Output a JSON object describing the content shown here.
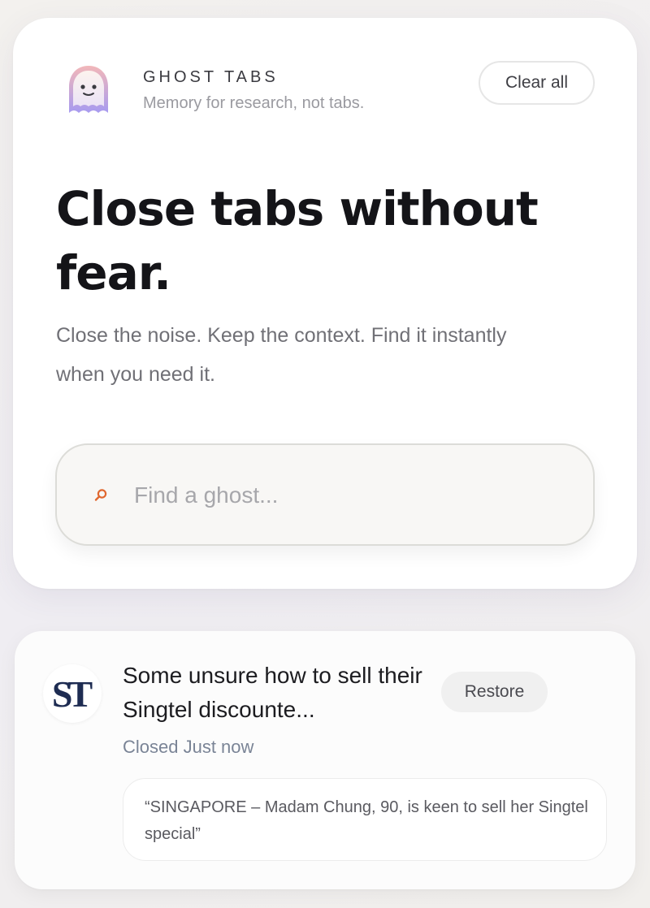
{
  "header": {
    "brand_name": "GHOST TABS",
    "tagline": "Memory for research, not tabs.",
    "clear_all_label": "Clear all"
  },
  "hero": {
    "heading": "Close tabs without fear.",
    "subtitle": "Close the noise. Keep the context. Find it instantly when you need it."
  },
  "search": {
    "placeholder": "Find a ghost...",
    "value": "",
    "icon": "search-icon"
  },
  "tabs": [
    {
      "favicon_text": "ST",
      "title": "Some unsure how to sell their Singtel discounte...",
      "closed_label": "Closed Just now",
      "restore_label": "Restore",
      "snippet": "“SINGAPORE – Madam Chung, 90, is keen to sell her Singtel special”"
    }
  ],
  "colors": {
    "accent": "#e0672f",
    "logo_gradient_top": "#f2b7b9",
    "logo_gradient_bottom": "#a79bf0",
    "favicon_navy": "#1e2c52"
  }
}
